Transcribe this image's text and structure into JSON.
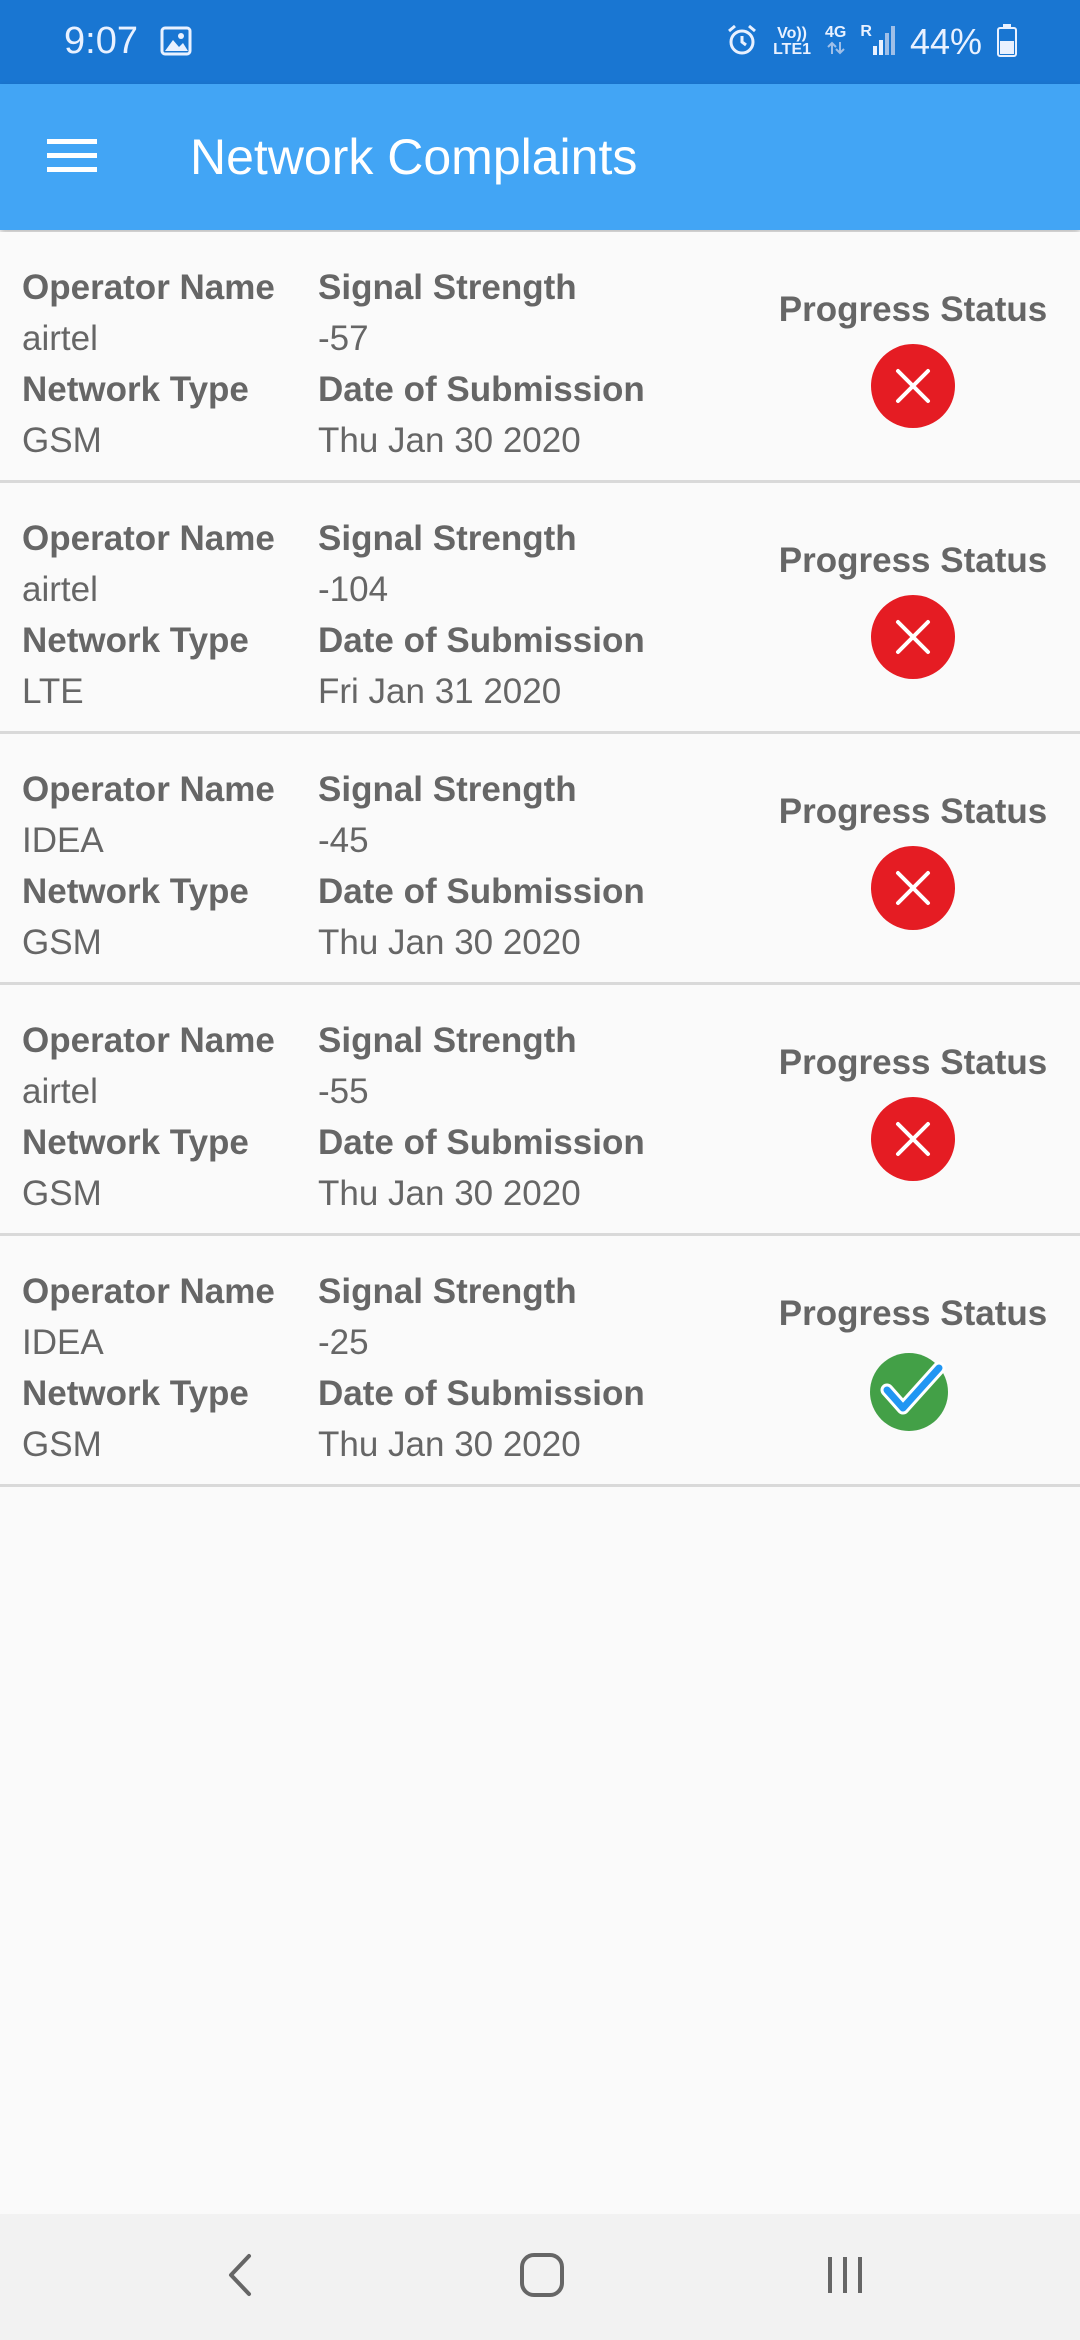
{
  "status_bar": {
    "time": "9:07",
    "image_icon": "image-icon",
    "alarm_icon": "alarm-icon",
    "volte_top": "Vo))",
    "volte_bottom": "LTE1",
    "network_gen": "4G",
    "roaming": "R",
    "signal_icon": "signal-icon",
    "battery_percent": "44%",
    "battery_icon": "battery-icon"
  },
  "app_bar": {
    "menu_icon": "menu-icon",
    "title": "Network Complaints"
  },
  "labels": {
    "operator_name": "Operator Name",
    "network_type": "Network Type",
    "signal_strength": "Signal Strength",
    "date_of_submission": "Date of Submission",
    "progress_status": "Progress Status"
  },
  "complaints": [
    {
      "operator": "airtel",
      "network_type": "GSM",
      "signal_strength": "-57",
      "date": "Thu Jan 30 2020",
      "status": "rejected",
      "status_icon": "red-x-circle-icon"
    },
    {
      "operator": "airtel",
      "network_type": "LTE",
      "signal_strength": "-104",
      "date": "Fri Jan 31 2020",
      "status": "rejected",
      "status_icon": "red-x-circle-icon"
    },
    {
      "operator": "IDEA",
      "network_type": "GSM",
      "signal_strength": "-45",
      "date": "Thu Jan 30 2020",
      "status": "rejected",
      "status_icon": "red-x-circle-icon"
    },
    {
      "operator": "airtel",
      "network_type": "GSM",
      "signal_strength": "-55",
      "date": "Thu Jan 30 2020",
      "status": "rejected",
      "status_icon": "red-x-circle-icon"
    },
    {
      "operator": "IDEA",
      "network_type": "GSM",
      "signal_strength": "-25",
      "date": "Thu Jan 30 2020",
      "status": "resolved",
      "status_icon": "green-check-circle-icon"
    }
  ],
  "nav_bar": {
    "back_icon": "back-icon",
    "home_icon": "home-icon",
    "recents_icon": "recents-icon"
  },
  "colors": {
    "status_bar": "#1976d2",
    "app_bar": "#42a5f5",
    "rejected": "#e51c23",
    "resolved": "#43a047",
    "check": "#2196f3",
    "text": "#666666"
  }
}
